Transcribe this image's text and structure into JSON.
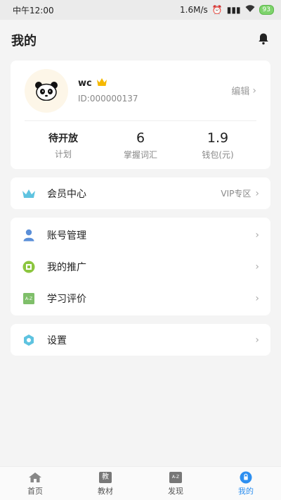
{
  "status": {
    "time": "中午12:00",
    "speed": "1.6M/s",
    "battery": "93"
  },
  "header": {
    "title": "我的",
    "bell_icon": "bell-icon"
  },
  "profile": {
    "name": "wc",
    "id": "ID:000000137",
    "edit_label": "编辑",
    "stats": [
      {
        "value": "待开放",
        "label": "计划"
      },
      {
        "value": "6",
        "label": "掌握词汇"
      },
      {
        "value": "1.9",
        "label": "钱包(元)"
      }
    ]
  },
  "member": {
    "label": "会员中心",
    "extra": "VIP专区"
  },
  "menu": [
    {
      "label": "账号管理",
      "icon": "user-icon"
    },
    {
      "label": "我的推广",
      "icon": "promo-icon"
    },
    {
      "label": "学习评价",
      "icon": "az-book-icon"
    }
  ],
  "settings": {
    "label": "设置"
  },
  "tabs": [
    {
      "label": "首页",
      "icon": "home-icon"
    },
    {
      "label": "教材",
      "icon": "textbook-icon",
      "icon_text": "教"
    },
    {
      "label": "发现",
      "icon": "discover-icon",
      "icon_text": "A-Z"
    },
    {
      "label": "我的",
      "icon": "profile-icon"
    }
  ],
  "colors": {
    "accent": "#2d8ff0",
    "crown": "#f5b800"
  }
}
